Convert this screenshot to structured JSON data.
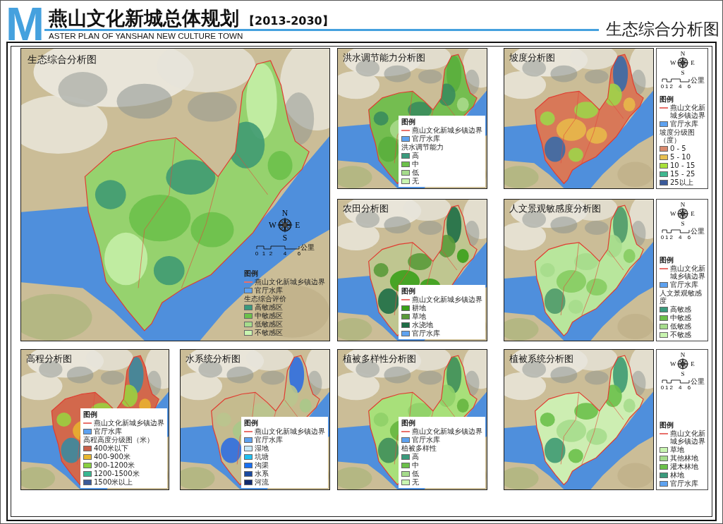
{
  "header": {
    "logo_letter": "M",
    "title": "燕山文化新城总体规划",
    "years": "【2013-2030】",
    "subtitle": "ASTER PLAN OF YANSHAN NEW CULTURE TOWN",
    "sheet_title": "生态综合分析图"
  },
  "maps": [
    {
      "kind": "ecology",
      "title": "生态综合分析图",
      "compass": {
        "north": "N",
        "east": "E",
        "south": "S",
        "west": "W"
      },
      "scale": {
        "ticks": [
          "0",
          "1",
          "2",
          "4",
          "6"
        ],
        "unit": "公里"
      },
      "legend": {
        "title": "图例",
        "rows": [
          {
            "kind": "line",
            "label": "燕山文化新城乡镇边界",
            "color": "#e8706a"
          },
          {
            "kind": "swatch",
            "label": "官厅水库",
            "color": "#5ea2f0"
          },
          {
            "kind": "heading",
            "label": "生态综合评价"
          },
          {
            "kind": "swatch",
            "label": "高敏感区",
            "color": "#3a9a7c"
          },
          {
            "kind": "swatch",
            "label": "中敏感区",
            "color": "#6cc04a"
          },
          {
            "kind": "swatch",
            "label": "低敏感区",
            "color": "#a6dc8c"
          },
          {
            "kind": "swatch",
            "label": "不敏感区",
            "color": "#c8f5b0"
          }
        ]
      }
    },
    {
      "kind": "flood",
      "title": "洪水调节能力分析图",
      "legend": {
        "title": "图例",
        "rows": [
          {
            "kind": "line",
            "label": "燕山文化新城乡镇边界",
            "color": "#e8706a"
          },
          {
            "kind": "swatch",
            "label": "官厅水库",
            "color": "#5ea2f0"
          },
          {
            "kind": "heading",
            "label": "洪水调节能力"
          },
          {
            "kind": "swatch",
            "label": "高",
            "color": "#3a9a7c"
          },
          {
            "kind": "swatch",
            "label": "中",
            "color": "#6cc04a"
          },
          {
            "kind": "swatch",
            "label": "低",
            "color": "#a6dc8c"
          },
          {
            "kind": "swatch",
            "label": "无",
            "color": "#c8f5b0"
          }
        ]
      }
    },
    {
      "kind": "slope",
      "title": "坡度分析图",
      "compass": {
        "north": "N",
        "east": "E",
        "south": "S",
        "west": "W"
      },
      "scale": {
        "ticks": [
          "0",
          "1",
          "2",
          "4",
          "6"
        ],
        "unit": "公里"
      },
      "legend": {
        "title": "图例",
        "rows": [
          {
            "kind": "line",
            "label": "燕山文化新城乡镇边界",
            "color": "#e8706a"
          },
          {
            "kind": "swatch",
            "label": "官厅水库",
            "color": "#5ea2f0"
          },
          {
            "kind": "heading",
            "label": "坡度分级图（度）"
          },
          {
            "kind": "swatch",
            "label": "0 - 5",
            "color": "#d98a6e"
          },
          {
            "kind": "swatch",
            "label": "5 - 10",
            "color": "#e8c050"
          },
          {
            "kind": "swatch",
            "label": "10 - 15",
            "color": "#a8e03a"
          },
          {
            "kind": "swatch",
            "label": "15 - 25",
            "color": "#40b890"
          },
          {
            "kind": "swatch",
            "label": "25以上",
            "color": "#3a5a9a"
          }
        ]
      }
    },
    {
      "kind": "farmland",
      "title": "农田分析图",
      "legend": {
        "title": "图例",
        "rows": [
          {
            "kind": "line",
            "label": "燕山文化新城乡镇边界",
            "color": "#e8706a"
          },
          {
            "kind": "swatch",
            "label": "耕地",
            "color": "#3aa01a"
          },
          {
            "kind": "swatch",
            "label": "草地",
            "color": "#5a9a3a"
          },
          {
            "kind": "swatch",
            "label": "水浇地",
            "color": "#1e6e46"
          },
          {
            "kind": "swatch",
            "label": "官厅水库",
            "color": "#5ea2f0"
          }
        ]
      }
    },
    {
      "kind": "landscape",
      "title": "人文景观敏感度分析图",
      "compass": {
        "north": "N",
        "east": "E",
        "south": "S",
        "west": "W"
      },
      "scale": {
        "ticks": [
          "0",
          "1",
          "2",
          "4",
          "6"
        ],
        "unit": "公里"
      },
      "legend": {
        "title": "图例",
        "rows": [
          {
            "kind": "line",
            "label": "燕山文化新城乡镇边界",
            "color": "#e8706a"
          },
          {
            "kind": "swatch",
            "label": "官厅水库",
            "color": "#5ea2f0"
          },
          {
            "kind": "heading",
            "label": "人文景观敏感度"
          },
          {
            "kind": "swatch",
            "label": "高敏感",
            "color": "#3a9a7c"
          },
          {
            "kind": "swatch",
            "label": "中敏感",
            "color": "#6cc04a"
          },
          {
            "kind": "swatch",
            "label": "低敏感",
            "color": "#a6dc8c"
          },
          {
            "kind": "swatch",
            "label": "不敏感",
            "color": "#c8f5b0"
          }
        ]
      }
    },
    {
      "kind": "elevation",
      "title": "高程分析图",
      "legend": {
        "title": "图例",
        "rows": [
          {
            "kind": "line",
            "label": "燕山文化新城乡镇边界",
            "color": "#e8706a"
          },
          {
            "kind": "swatch",
            "label": "官厅水库",
            "color": "#5ea2f0"
          },
          {
            "kind": "heading",
            "label": "高程高度分级图（米）"
          },
          {
            "kind": "swatch",
            "label": "400米以下",
            "color": "#c8604a"
          },
          {
            "kind": "swatch",
            "label": "400-900米",
            "color": "#e8b830"
          },
          {
            "kind": "swatch",
            "label": "900-1200米",
            "color": "#8ad040"
          },
          {
            "kind": "swatch",
            "label": "1200-1500米",
            "color": "#3ab890"
          },
          {
            "kind": "swatch",
            "label": "1500米以上",
            "color": "#3a5a9a"
          }
        ]
      }
    },
    {
      "kind": "water",
      "title": "水系统分析图",
      "legend": {
        "title": "图例",
        "rows": [
          {
            "kind": "line",
            "label": "燕山文化新城乡镇边界",
            "color": "#e8706a"
          },
          {
            "kind": "swatch",
            "label": "官厅水库",
            "color": "#5ea2f0"
          },
          {
            "kind": "swatch",
            "label": "湿地",
            "color": "#c8e8f8"
          },
          {
            "kind": "swatch",
            "label": "坑塘",
            "color": "#20c0f0"
          },
          {
            "kind": "swatch",
            "label": "沟渠",
            "color": "#1a70f0"
          },
          {
            "kind": "swatch",
            "label": "水系",
            "color": "#1a4aa0"
          },
          {
            "kind": "swatch",
            "label": "河流",
            "color": "#102a70"
          }
        ]
      }
    },
    {
      "kind": "diversity",
      "title": "植被多样性分析图",
      "legend": {
        "title": "图例",
        "rows": [
          {
            "kind": "line",
            "label": "燕山文化新城乡镇边界",
            "color": "#e8706a"
          },
          {
            "kind": "swatch",
            "label": "官厅水库",
            "color": "#5ea2f0"
          },
          {
            "kind": "heading",
            "label": "植被多样性"
          },
          {
            "kind": "swatch",
            "label": "高",
            "color": "#3a9a7c"
          },
          {
            "kind": "swatch",
            "label": "中",
            "color": "#6cc04a"
          },
          {
            "kind": "swatch",
            "label": "低",
            "color": "#a6dc8c"
          },
          {
            "kind": "swatch",
            "label": "无",
            "color": "#c8f5b0"
          }
        ]
      }
    },
    {
      "kind": "vegetation",
      "title": "植被系统分析图",
      "compass": {
        "north": "N",
        "east": "E",
        "south": "S",
        "west": "W"
      },
      "scale": {
        "ticks": [
          "0",
          "1",
          "2",
          "4",
          "6"
        ],
        "unit": "公里"
      },
      "legend": {
        "title": "图例",
        "rows": [
          {
            "kind": "line",
            "label": "燕山文化新城乡镇边界",
            "color": "#e8706a"
          },
          {
            "kind": "swatch",
            "label": "草地",
            "color": "#c8f5b0"
          },
          {
            "kind": "swatch",
            "label": "其他林地",
            "color": "#a6dc8c"
          },
          {
            "kind": "swatch",
            "label": "灌木林地",
            "color": "#6cc04a"
          },
          {
            "kind": "swatch",
            "label": "林地",
            "color": "#3a9a7c"
          },
          {
            "kind": "swatch",
            "label": "官厅水库",
            "color": "#5ea2f0"
          }
        ]
      }
    }
  ]
}
